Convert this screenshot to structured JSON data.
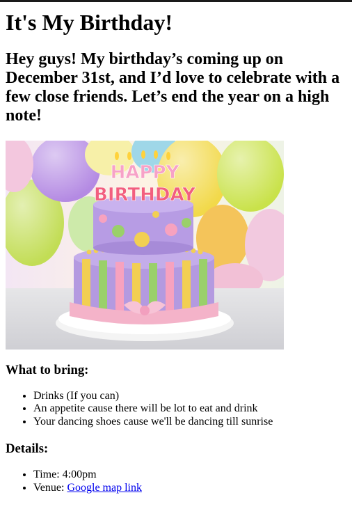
{
  "page": {
    "title": "It's My Birthday!",
    "intro": "Hey guys! My birthday’s coming up on December 31st, and I’d love to celebrate with a few close friends. Let’s end the year on a high note!"
  },
  "image": {
    "alt": "Birthday cake with HAPPY BIRTHDAY candles",
    "candle_line1": "HAPPY",
    "candle_line2": "BIRTHDAY"
  },
  "bring": {
    "heading": "What to bring:",
    "items": [
      "Drinks (If you can)",
      "An appetite cause there will be lot to eat and drink",
      "Your dancing shoes cause we'll be dancing till sunrise"
    ]
  },
  "details": {
    "heading": "Details:",
    "time_text": "Time: 4:00pm",
    "venue_label": "Venue: ",
    "venue_link": "Google map link"
  },
  "colors": {
    "link": "#0000ee",
    "cake_purple": "#a58bd6",
    "ribbon_pink": "#f4b3c9",
    "stripe_yellow": "#f2cf52"
  }
}
